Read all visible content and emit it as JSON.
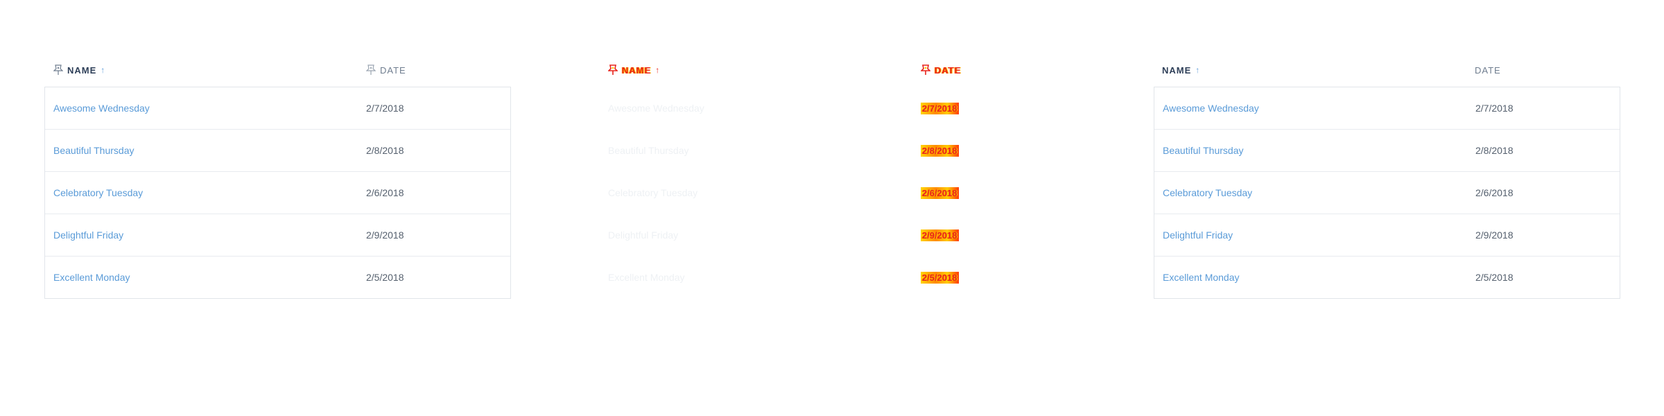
{
  "colors": {
    "header_text": "#2e3f58",
    "header_secondary": "#6f7d8f",
    "link": "#5a9bd8",
    "cell_text": "#55606e",
    "border": "#e1e5ea",
    "glitch_red": "#e8241c",
    "glitch_yellow": "#ffcc00"
  },
  "tables": {
    "left": {
      "columns": {
        "name": "Name",
        "date": "Date",
        "sort_indicator": "↑"
      },
      "rows": [
        {
          "name": "Awesome Wednesday",
          "date": "2/7/2018"
        },
        {
          "name": "Beautiful Thursday",
          "date": "2/8/2018"
        },
        {
          "name": "Celebratory Tuesday",
          "date": "2/6/2018"
        },
        {
          "name": "Delightful Friday",
          "date": "2/9/2018"
        },
        {
          "name": "Excellent Monday",
          "date": "2/5/2018"
        }
      ]
    },
    "middle": {
      "columns": {
        "name": "Name",
        "date": "Date",
        "sort_indicator": "↑"
      },
      "rows": [
        {
          "name": "Awesome Wednesday",
          "date": "2/7/2018"
        },
        {
          "name": "Beautiful Thursday",
          "date": "2/8/2018"
        },
        {
          "name": "Celebratory Tuesday",
          "date": "2/6/2018"
        },
        {
          "name": "Delightful Friday",
          "date": "2/9/2018"
        },
        {
          "name": "Excellent Monday",
          "date": "2/5/2018"
        }
      ]
    },
    "right": {
      "columns": {
        "name": "Name",
        "date": "Date",
        "sort_indicator": "↑"
      },
      "rows": [
        {
          "name": "Awesome Wednesday",
          "date": "2/7/2018"
        },
        {
          "name": "Beautiful Thursday",
          "date": "2/8/2018"
        },
        {
          "name": "Celebratory Tuesday",
          "date": "2/6/2018"
        },
        {
          "name": "Delightful Friday",
          "date": "2/9/2018"
        },
        {
          "name": "Excellent Monday",
          "date": "2/5/2018"
        }
      ]
    }
  }
}
